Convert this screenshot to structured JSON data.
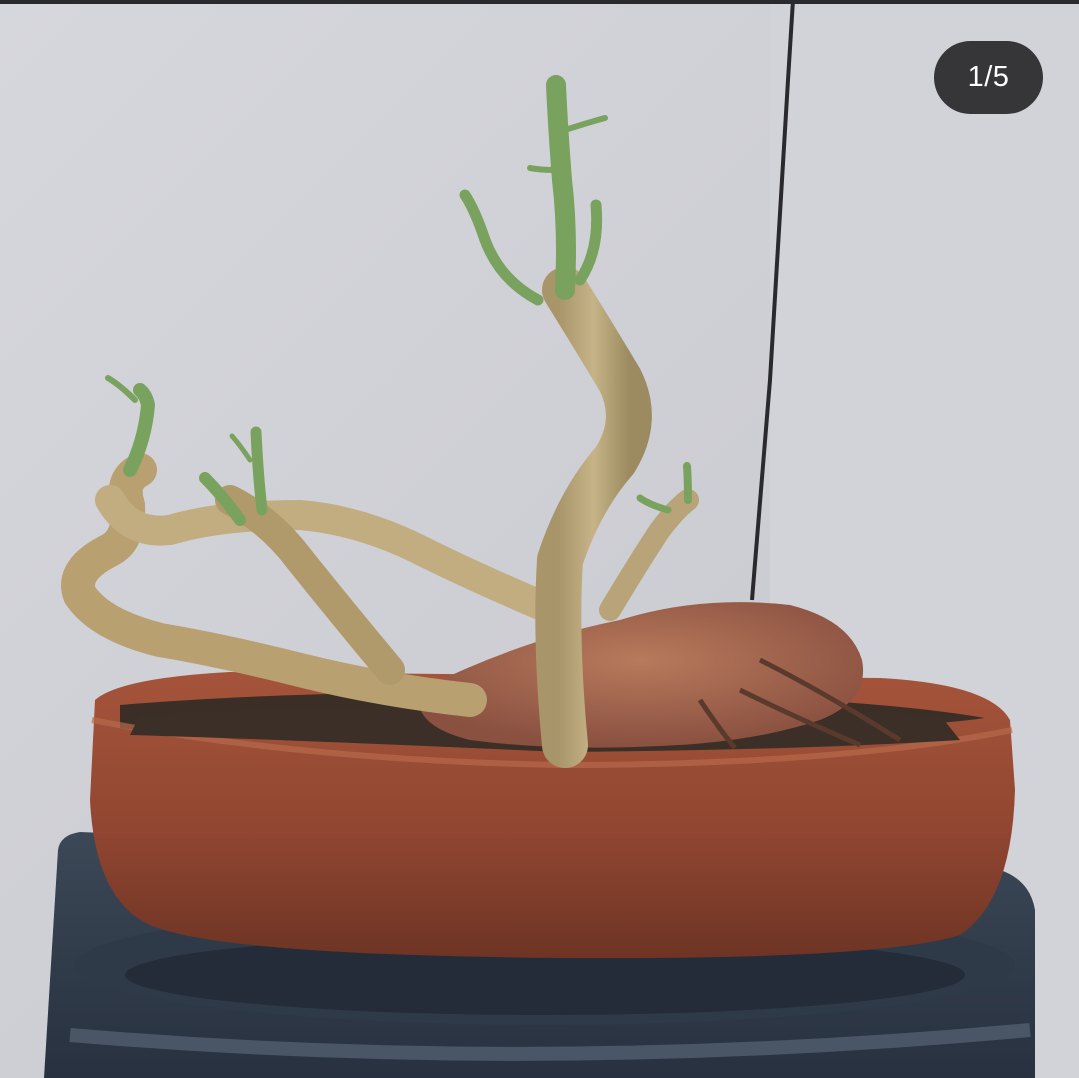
{
  "carousel": {
    "counter_text": "1/5",
    "current": 1,
    "total": 5
  },
  "photo": {
    "subject": "bonsai-tree-in-terracotta-pot",
    "colors": {
      "wall": "#cfd0d6",
      "wall_joint": "#2a2a2e",
      "pot": "#9a4a32",
      "pot_dark": "#6e3424",
      "stand": "#34404e",
      "trunk": "#b8a478",
      "shoots": "#6f9a5a",
      "soil": "#3a2e26"
    }
  },
  "ui": {
    "counter_bg": "#202022",
    "counter_fg": "#ffffff"
  }
}
